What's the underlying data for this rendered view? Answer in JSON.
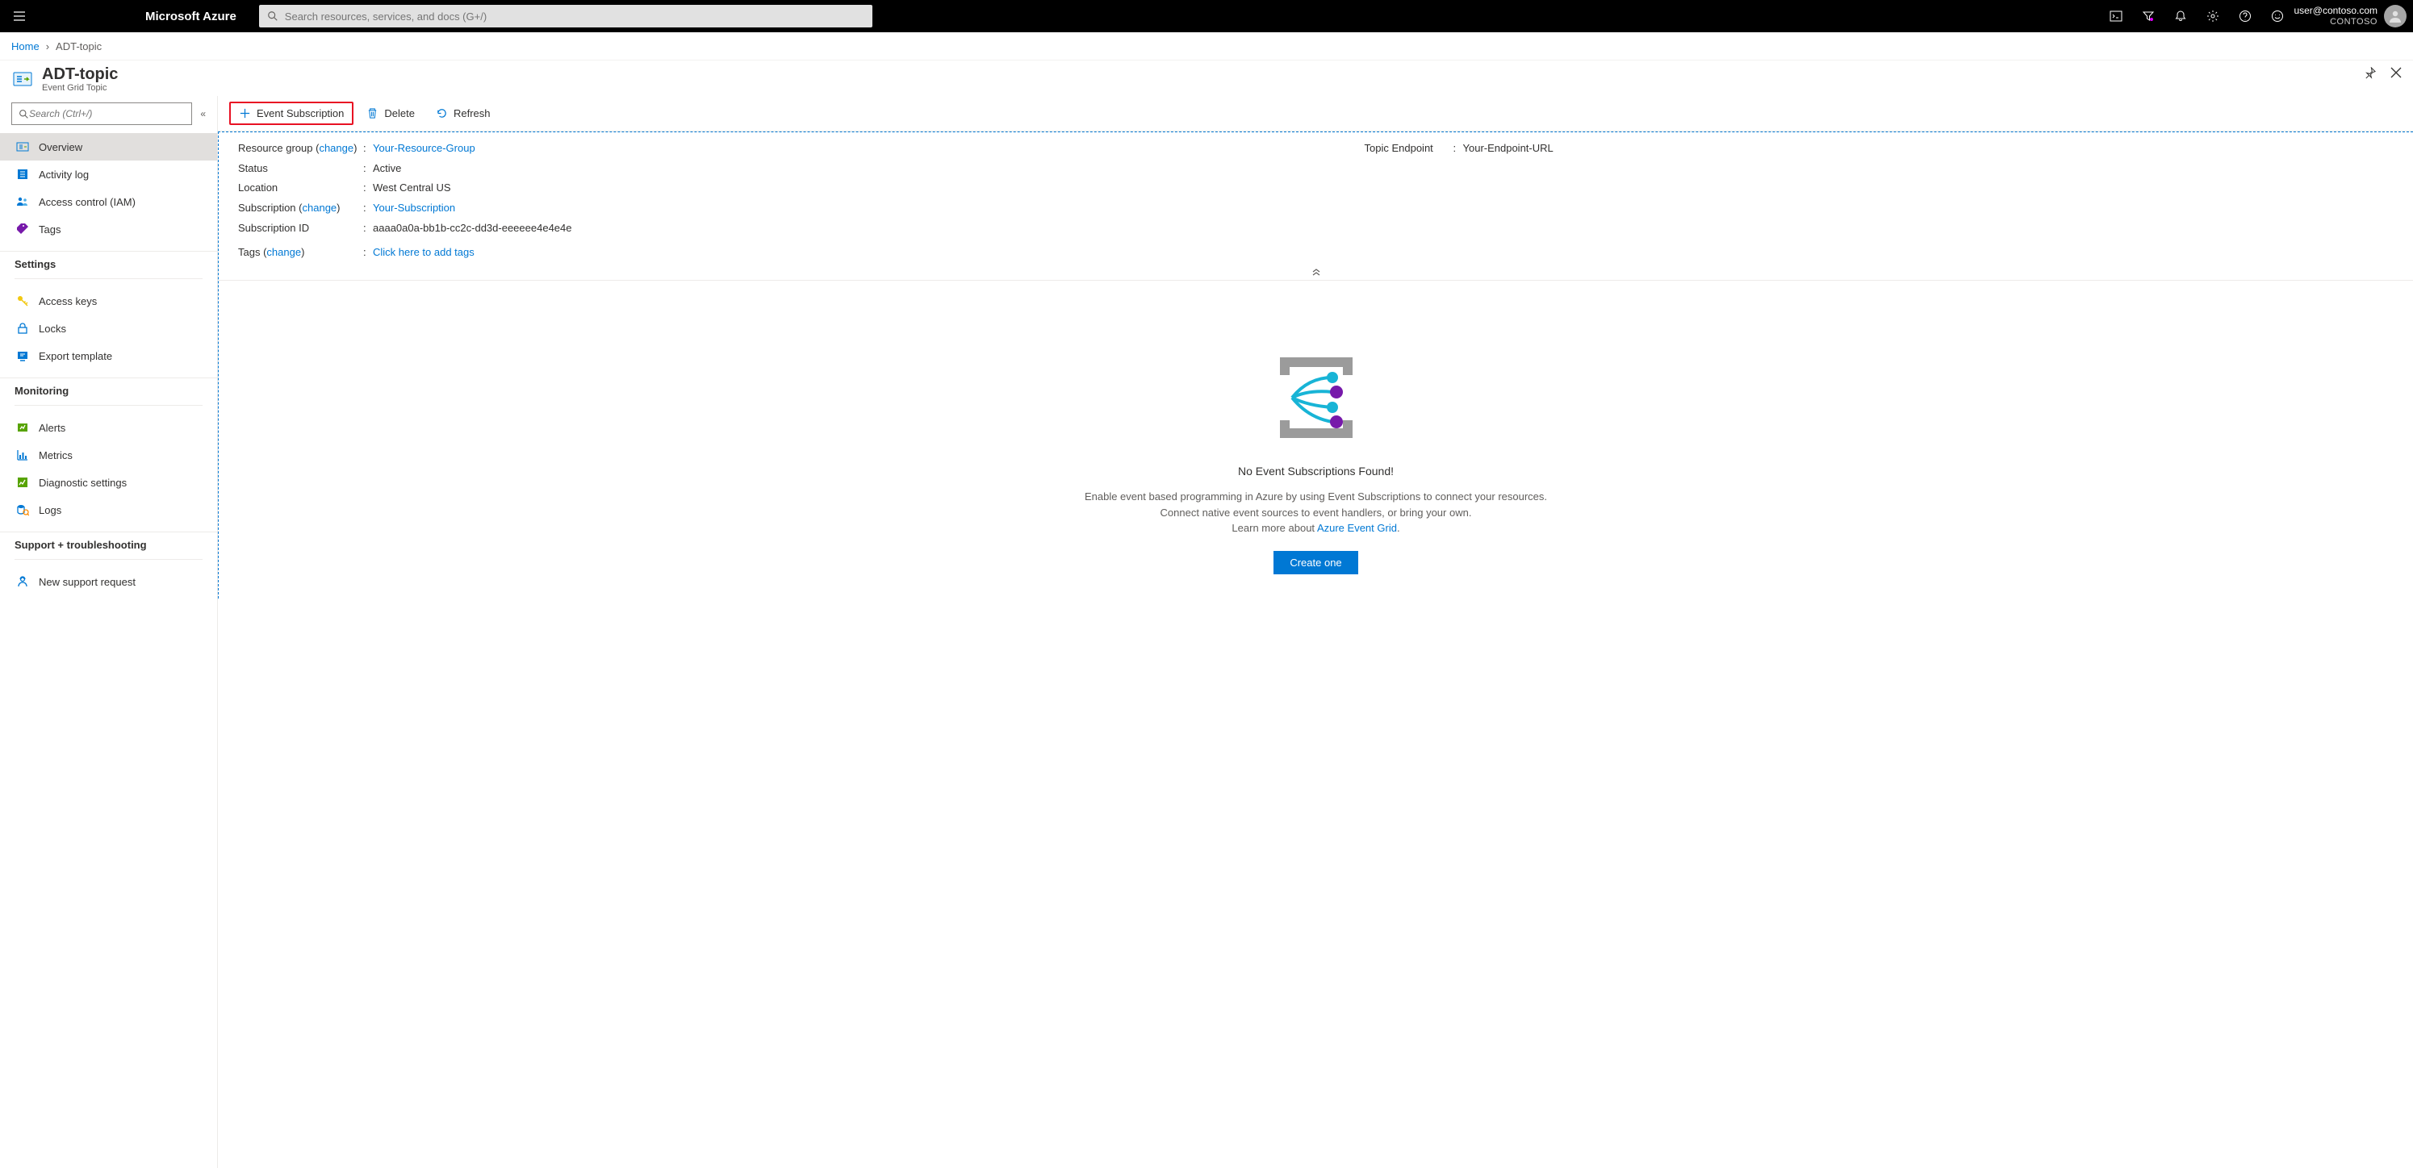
{
  "topbar": {
    "brand": "Microsoft Azure",
    "search_placeholder": "Search resources, services, and docs (G+/)",
    "user_email": "user@contoso.com",
    "tenant": "CONTOSO"
  },
  "breadcrumb": {
    "home": "Home",
    "current": "ADT-topic"
  },
  "header": {
    "title": "ADT-topic",
    "subtitle": "Event Grid Topic"
  },
  "sidebar": {
    "search_placeholder": "Search (Ctrl+/)",
    "items_top": [
      {
        "label": "Overview"
      },
      {
        "label": "Activity log"
      },
      {
        "label": "Access control (IAM)"
      },
      {
        "label": "Tags"
      }
    ],
    "section_settings": "Settings",
    "items_settings": [
      {
        "label": "Access keys"
      },
      {
        "label": "Locks"
      },
      {
        "label": "Export template"
      }
    ],
    "section_monitoring": "Monitoring",
    "items_monitoring": [
      {
        "label": "Alerts"
      },
      {
        "label": "Metrics"
      },
      {
        "label": "Diagnostic settings"
      },
      {
        "label": "Logs"
      }
    ],
    "section_support": "Support + troubleshooting",
    "items_support": [
      {
        "label": "New support request"
      }
    ]
  },
  "toolbar": {
    "event_subscription": "Event Subscription",
    "delete": "Delete",
    "refresh": "Refresh"
  },
  "essentials": {
    "resource_group_label": "Resource group",
    "change": "change",
    "resource_group_value": "Your-Resource-Group",
    "status_label": "Status",
    "status_value": "Active",
    "location_label": "Location",
    "location_value": "West Central US",
    "subscription_label": "Subscription",
    "subscription_value": "Your-Subscription",
    "subscription_id_label": "Subscription ID",
    "subscription_id_value": "aaaa0a0a-bb1b-cc2c-dd3d-eeeeee4e4e4e",
    "tags_label": "Tags",
    "tags_value": "Click here to add tags",
    "topic_endpoint_label": "Topic Endpoint",
    "topic_endpoint_value": "Your-Endpoint-URL"
  },
  "empty": {
    "title": "No Event Subscriptions Found!",
    "line1": "Enable event based programming in Azure by using Event Subscriptions to connect your resources.",
    "line2": "Connect native event sources to event handlers, or bring your own.",
    "learn_prefix": "Learn more about ",
    "learn_link": "Azure Event Grid",
    "button": "Create one"
  }
}
